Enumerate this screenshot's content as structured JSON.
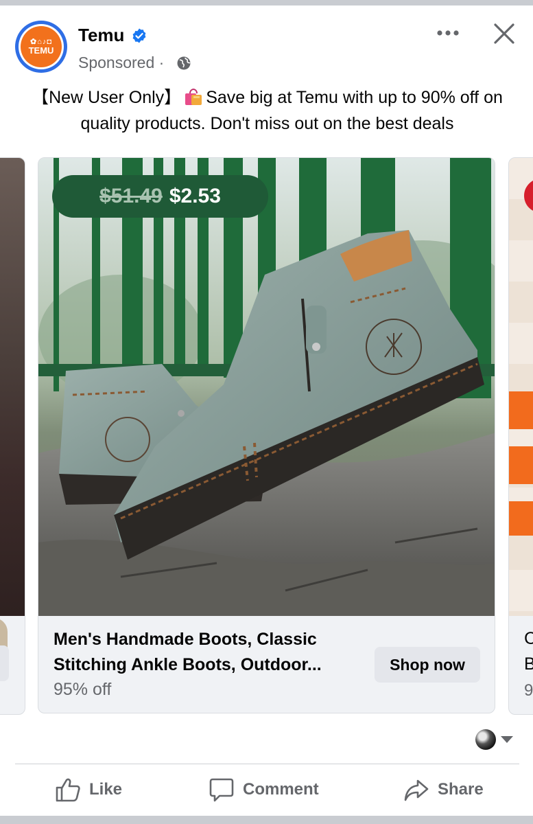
{
  "post": {
    "page_name": "Temu",
    "avatar_text": "TEMU",
    "sponsored_label": "Sponsored",
    "separator": "·",
    "caption_part1": "【New User Only】",
    "caption_part2": "Save big at Temu with up to 90% off on quality products. Don't miss out on the best deals"
  },
  "icons": {
    "verified": "verified-badge-icon",
    "audience": "globe-icon",
    "more": "more-options-icon",
    "close": "close-icon",
    "caption_emoji": "shopping-bags-emoji"
  },
  "carousel": {
    "main_card": {
      "price_old": "$51.49",
      "price_new": "$2.53",
      "title": "Men's Handmade Boots, Classic Stitching Ankle Boots, Outdoor...",
      "subtitle": "95% off",
      "cta_label": "Shop now"
    },
    "next_card": {
      "title_start": "C",
      "title_line2_start": "B",
      "subtitle_start": "9"
    }
  },
  "actions": {
    "like": "Like",
    "comment": "Comment",
    "share": "Share"
  },
  "colors": {
    "brand_orange": "#f2711c",
    "verified_blue": "#1877f2",
    "price_pill": "#1f5a37",
    "secondary_text": "#65676b"
  }
}
